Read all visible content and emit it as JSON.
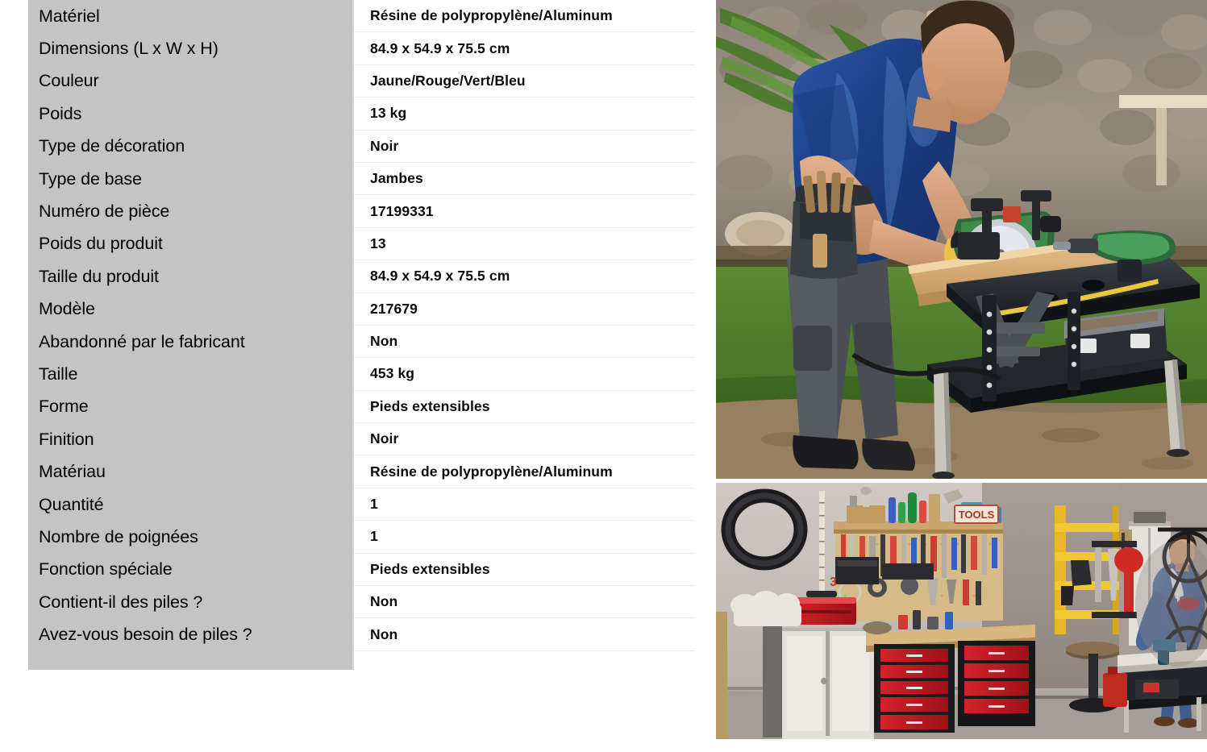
{
  "spec_table": {
    "rows": [
      {
        "label": "Matériel",
        "value": "Résine de polypropylène/Aluminum"
      },
      {
        "label": "Dimensions (L x W x H)",
        "value": "84.9 x 54.9 x 75.5 cm"
      },
      {
        "label": "Couleur",
        "value": "Jaune/Rouge/Vert/Bleu"
      },
      {
        "label": "Poids",
        "value": "13 kg"
      },
      {
        "label": "Type de décoration",
        "value": "Noir"
      },
      {
        "label": "Type de base",
        "value": "Jambes"
      },
      {
        "label": "Numéro de pièce",
        "value": "17199331"
      },
      {
        "label": "Poids du produit",
        "value": "13"
      },
      {
        "label": "Taille du produit",
        "value": "84.9 x 54.9 x 75.5 cm"
      },
      {
        "label": "Modèle",
        "value": "217679"
      },
      {
        "label": "Abandonné par le fabricant",
        "value": "Non"
      },
      {
        "label": "Taille",
        "value": "453 kg"
      },
      {
        "label": "Forme",
        "value": "Pieds extensibles"
      },
      {
        "label": "Finition",
        "value": "Noir"
      },
      {
        "label": "Matériau",
        "value": "Résine de polypropylène/Aluminum"
      },
      {
        "label": "Quantité",
        "value": "1"
      },
      {
        "label": "Nombre de poignées",
        "value": "1"
      },
      {
        "label": "Fonction spéciale",
        "value": "Pieds extensibles"
      },
      {
        "label": "Contient-il des piles ?",
        "value": "Non"
      },
      {
        "label": "Avez-vous besoin de piles ?",
        "value": "Non"
      }
    ]
  },
  "photos": {
    "top": {
      "name": "outdoor-workbench-photo",
      "description": "Homme en t-shirt bleu avec gants jaunes sciant une planche sur un établi pliant noir devant un tas de bûches"
    },
    "bottom": {
      "name": "garage-workbench-photo",
      "description": "Homme en sweat à capuche bleu travaillant sur un établi pliant dans un garage avec panneau d'outils, coffres rouges, échelle jaune et vélo"
    }
  },
  "colors": {
    "label_background": "#c4c4c4",
    "row_separator": "#ececec",
    "text": "#000000"
  }
}
